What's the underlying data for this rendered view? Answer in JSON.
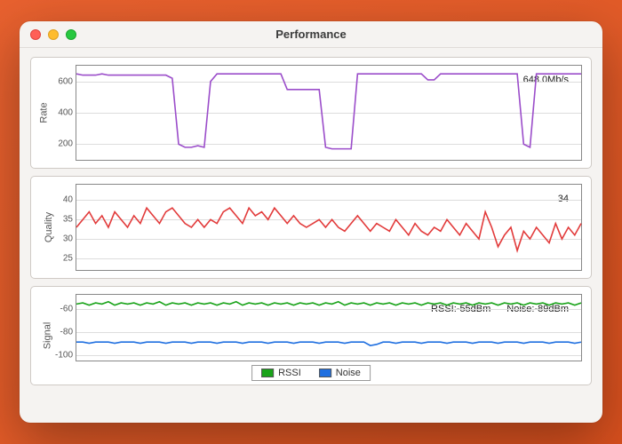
{
  "window": {
    "title": "Performance"
  },
  "charts": {
    "rate": {
      "ylabel": "Rate",
      "readout": "648.0Mb/s",
      "color": "#9b4dca"
    },
    "quality": {
      "ylabel": "Quality",
      "readout": "34",
      "color": "#e23b3b"
    },
    "signal": {
      "ylabel": "Signal",
      "readout_rssi": "RSSI:-55dBm",
      "readout_noise": "Noise:-89dBm",
      "rssi_color": "#19a319",
      "noise_color": "#1f6fe0"
    }
  },
  "legend": {
    "rssi": "RSSI",
    "noise": "Noise"
  },
  "chart_data": [
    {
      "type": "line",
      "title": "Rate",
      "ylabel": "Rate",
      "ylim": [
        100,
        700
      ],
      "yticks": [
        200,
        400,
        600
      ],
      "x": [
        0,
        1,
        2,
        3,
        4,
        5,
        6,
        7,
        8,
        9,
        10,
        11,
        12,
        13,
        14,
        15,
        16,
        17,
        18,
        19,
        20,
        21,
        22,
        23,
        24,
        25,
        26,
        27,
        28,
        29,
        30,
        31,
        32,
        33,
        34,
        35,
        36,
        37,
        38,
        39,
        40,
        41,
        42,
        43,
        44,
        45,
        46,
        47,
        48,
        49,
        50,
        51,
        52,
        53,
        54,
        55,
        56,
        57,
        58,
        59,
        60,
        61,
        62,
        63,
        64,
        65,
        66,
        67,
        68,
        69,
        70,
        71,
        72,
        73,
        74,
        75,
        76,
        77,
        78,
        79
      ],
      "series": [
        {
          "name": "Rate",
          "color": "#9b4dca",
          "values": [
            648,
            640,
            640,
            640,
            648,
            640,
            640,
            640,
            640,
            640,
            640,
            640,
            640,
            640,
            640,
            620,
            200,
            180,
            180,
            190,
            180,
            600,
            648,
            648,
            648,
            648,
            648,
            648,
            648,
            648,
            648,
            648,
            648,
            548,
            548,
            548,
            548,
            548,
            548,
            180,
            170,
            170,
            170,
            170,
            648,
            648,
            648,
            648,
            648,
            648,
            648,
            648,
            648,
            648,
            648,
            610,
            610,
            648,
            648,
            648,
            648,
            648,
            648,
            648,
            648,
            648,
            648,
            648,
            648,
            648,
            200,
            180,
            648,
            648,
            648,
            648,
            648,
            648,
            648,
            648
          ]
        }
      ]
    },
    {
      "type": "line",
      "title": "Quality",
      "ylabel": "Quality",
      "ylim": [
        22,
        44
      ],
      "yticks": [
        25,
        30,
        35,
        40
      ],
      "x": [
        0,
        1,
        2,
        3,
        4,
        5,
        6,
        7,
        8,
        9,
        10,
        11,
        12,
        13,
        14,
        15,
        16,
        17,
        18,
        19,
        20,
        21,
        22,
        23,
        24,
        25,
        26,
        27,
        28,
        29,
        30,
        31,
        32,
        33,
        34,
        35,
        36,
        37,
        38,
        39,
        40,
        41,
        42,
        43,
        44,
        45,
        46,
        47,
        48,
        49,
        50,
        51,
        52,
        53,
        54,
        55,
        56,
        57,
        58,
        59,
        60,
        61,
        62,
        63,
        64,
        65,
        66,
        67,
        68,
        69,
        70,
        71,
        72,
        73,
        74,
        75,
        76,
        77,
        78,
        79
      ],
      "series": [
        {
          "name": "Quality",
          "color": "#e23b3b",
          "values": [
            33,
            35,
            37,
            34,
            36,
            33,
            37,
            35,
            33,
            36,
            34,
            38,
            36,
            34,
            37,
            38,
            36,
            34,
            33,
            35,
            33,
            35,
            34,
            37,
            38,
            36,
            34,
            38,
            36,
            37,
            35,
            38,
            36,
            34,
            36,
            34,
            33,
            34,
            35,
            33,
            35,
            33,
            32,
            34,
            36,
            34,
            32,
            34,
            33,
            32,
            35,
            33,
            31,
            34,
            32,
            31,
            33,
            32,
            35,
            33,
            31,
            34,
            32,
            30,
            37,
            33,
            28,
            31,
            33,
            27,
            32,
            30,
            33,
            31,
            29,
            34,
            30,
            33,
            31,
            34
          ]
        }
      ]
    },
    {
      "type": "line",
      "title": "Signal",
      "ylabel": "Signal",
      "ylim": [
        -105,
        -48
      ],
      "yticks": [
        -60,
        -80,
        -100
      ],
      "x": [
        0,
        1,
        2,
        3,
        4,
        5,
        6,
        7,
        8,
        9,
        10,
        11,
        12,
        13,
        14,
        15,
        16,
        17,
        18,
        19,
        20,
        21,
        22,
        23,
        24,
        25,
        26,
        27,
        28,
        29,
        30,
        31,
        32,
        33,
        34,
        35,
        36,
        37,
        38,
        39,
        40,
        41,
        42,
        43,
        44,
        45,
        46,
        47,
        48,
        49,
        50,
        51,
        52,
        53,
        54,
        55,
        56,
        57,
        58,
        59,
        60,
        61,
        62,
        63,
        64,
        65,
        66,
        67,
        68,
        69,
        70,
        71,
        72,
        73,
        74,
        75,
        76,
        77,
        78,
        79
      ],
      "series": [
        {
          "name": "RSSI",
          "color": "#19a319",
          "values": [
            -56,
            -55,
            -57,
            -55,
            -56,
            -54,
            -57,
            -55,
            -56,
            -55,
            -57,
            -55,
            -56,
            -54,
            -57,
            -55,
            -56,
            -55,
            -57,
            -55,
            -56,
            -55,
            -57,
            -55,
            -56,
            -54,
            -57,
            -55,
            -56,
            -55,
            -57,
            -55,
            -56,
            -55,
            -57,
            -55,
            -56,
            -55,
            -57,
            -55,
            -56,
            -54,
            -57,
            -55,
            -56,
            -55,
            -57,
            -55,
            -56,
            -55,
            -57,
            -55,
            -56,
            -55,
            -57,
            -55,
            -56,
            -55,
            -57,
            -55,
            -56,
            -55,
            -57,
            -55,
            -56,
            -55,
            -57,
            -55,
            -56,
            -55,
            -57,
            -55,
            -56,
            -55,
            -57,
            -55,
            -56,
            -55,
            -57,
            -55
          ]
        },
        {
          "name": "Noise",
          "color": "#1f6fe0",
          "values": [
            -89,
            -89,
            -90,
            -89,
            -89,
            -89,
            -90,
            -89,
            -89,
            -89,
            -90,
            -89,
            -89,
            -89,
            -90,
            -89,
            -89,
            -89,
            -90,
            -89,
            -89,
            -89,
            -90,
            -89,
            -89,
            -89,
            -90,
            -89,
            -89,
            -89,
            -90,
            -89,
            -89,
            -89,
            -90,
            -89,
            -89,
            -89,
            -90,
            -89,
            -89,
            -89,
            -90,
            -89,
            -89,
            -89,
            -92,
            -91,
            -89,
            -89,
            -90,
            -89,
            -89,
            -89,
            -90,
            -89,
            -89,
            -89,
            -90,
            -89,
            -89,
            -89,
            -90,
            -89,
            -89,
            -89,
            -90,
            -89,
            -89,
            -89,
            -90,
            -89,
            -89,
            -89,
            -90,
            -89,
            -89,
            -89,
            -90,
            -89
          ]
        }
      ]
    }
  ]
}
